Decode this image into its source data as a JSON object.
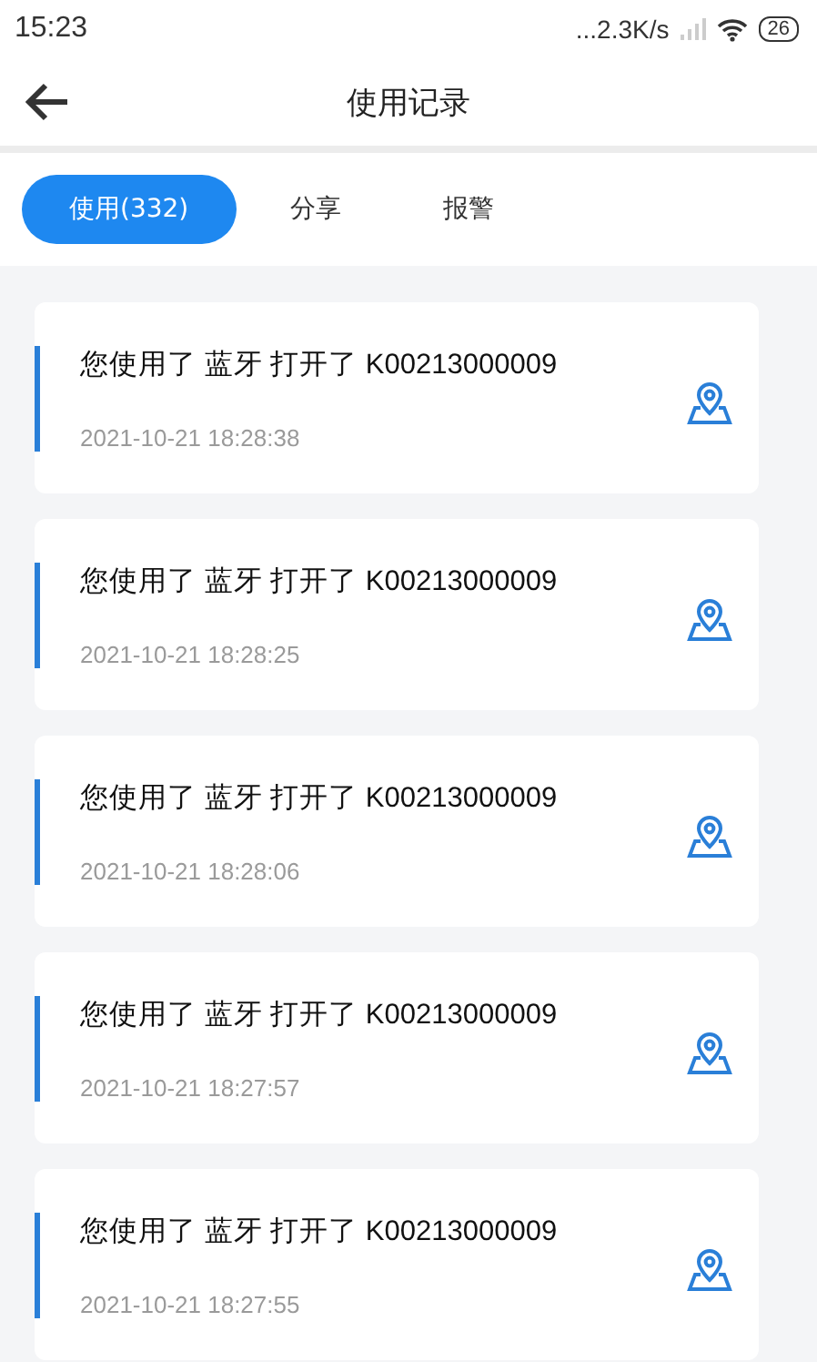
{
  "status_bar": {
    "time": "15:23",
    "speed": "...2.3K/s",
    "battery": "26"
  },
  "header": {
    "title": "使用记录"
  },
  "tabs": [
    {
      "label": "使用(332)",
      "selected": true
    },
    {
      "label": "分享",
      "selected": false
    },
    {
      "label": "报警",
      "selected": false
    }
  ],
  "records": [
    {
      "text": "您使用了 蓝牙 打开了 K00213000009",
      "time": "2021-10-21 18:28:38"
    },
    {
      "text": "您使用了 蓝牙 打开了 K00213000009",
      "time": "2021-10-21 18:28:25"
    },
    {
      "text": "您使用了 蓝牙 打开了 K00213000009",
      "time": "2021-10-21 18:28:06"
    },
    {
      "text": "您使用了 蓝牙 打开了 K00213000009",
      "time": "2021-10-21 18:27:57"
    },
    {
      "text": "您使用了 蓝牙 打开了 K00213000009",
      "time": "2021-10-21 18:27:55"
    }
  ]
}
